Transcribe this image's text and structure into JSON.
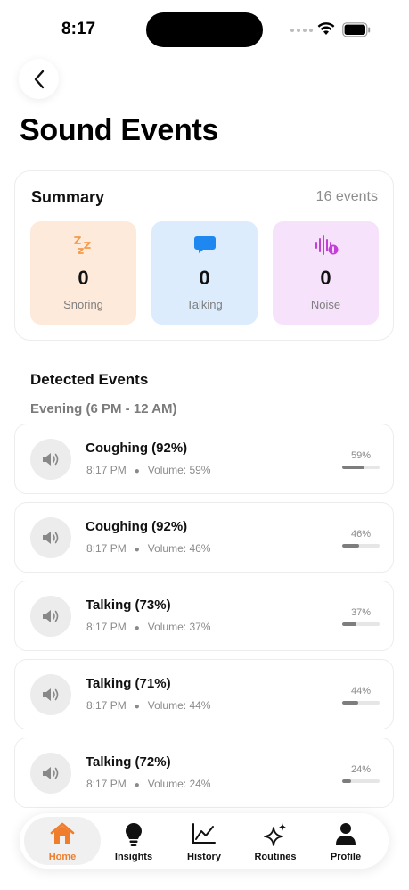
{
  "status_bar": {
    "time": "8:17"
  },
  "header": {
    "title": "Sound Events"
  },
  "summary": {
    "title": "Summary",
    "count": "16 events",
    "tiles": [
      {
        "value": "0",
        "label": "Snoring",
        "icon": "zzz-icon",
        "bg": "#fdeadb",
        "icon_color": "#f29a4a"
      },
      {
        "value": "0",
        "label": "Talking",
        "icon": "chat-bubble-icon",
        "bg": "#dcecfd",
        "icon_color": "#1e88f0"
      },
      {
        "value": "0",
        "label": "Noise",
        "icon": "waveform-alert-icon",
        "bg": "#f6e3fb",
        "icon_color": "#c43fd8"
      }
    ]
  },
  "events_section": {
    "title": "Detected Events",
    "group": "Evening (6 PM - 12 AM)",
    "items": [
      {
        "title": "Coughing (92%)",
        "time": "8:17 PM",
        "volume": "Volume: 59%",
        "pct": "59%",
        "level": 0.59
      },
      {
        "title": "Coughing (92%)",
        "time": "8:17 PM",
        "volume": "Volume: 46%",
        "pct": "46%",
        "level": 0.46
      },
      {
        "title": "Talking (73%)",
        "time": "8:17 PM",
        "volume": "Volume: 37%",
        "pct": "37%",
        "level": 0.37
      },
      {
        "title": "Talking (71%)",
        "time": "8:17 PM",
        "volume": "Volume: 44%",
        "pct": "44%",
        "level": 0.44
      },
      {
        "title": "Talking (72%)",
        "time": "8:17 PM",
        "volume": "Volume: 24%",
        "pct": "24%",
        "level": 0.24
      }
    ]
  },
  "tabbar": {
    "tabs": [
      {
        "label": "Home",
        "icon": "house-icon",
        "active": true
      },
      {
        "label": "Insights",
        "icon": "lightbulb-icon",
        "active": false
      },
      {
        "label": "History",
        "icon": "line-chart-icon",
        "active": false
      },
      {
        "label": "Routines",
        "icon": "sparkles-icon",
        "active": false
      },
      {
        "label": "Profile",
        "icon": "person-icon",
        "active": false
      }
    ]
  },
  "colors": {
    "accent": "#ef7d2b",
    "speaker_bg": "#ececec",
    "bar_fill": "#7d7d7d"
  }
}
